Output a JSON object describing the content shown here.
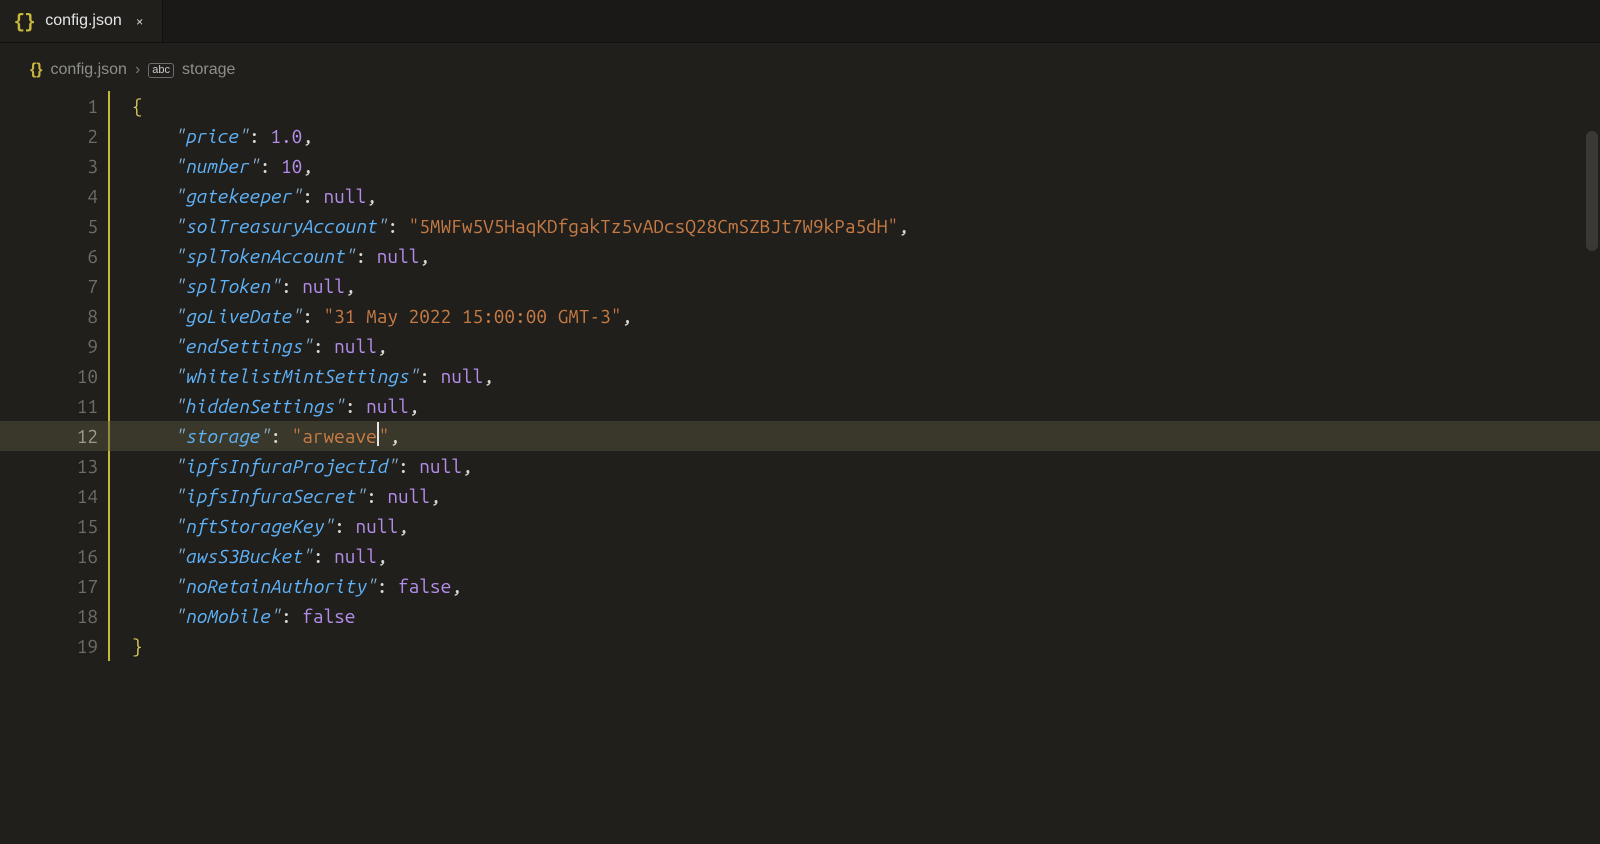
{
  "tab": {
    "icon": "{}",
    "filename": "config.json",
    "close": "×"
  },
  "breadcrumb": {
    "icon": "{}",
    "file": "config.json",
    "sep": "›",
    "fieldIcon": "abc",
    "field": "storage"
  },
  "gutter": [
    "1",
    "2",
    "3",
    "4",
    "5",
    "6",
    "7",
    "8",
    "9",
    "10",
    "11",
    "12",
    "13",
    "14",
    "15",
    "16",
    "17",
    "18",
    "19"
  ],
  "activeLineIndex": 11,
  "code": {
    "indent": "    ",
    "openBrace": "{",
    "closeBrace": "}",
    "items": [
      {
        "key": "price",
        "type": "num",
        "val": "1.0"
      },
      {
        "key": "number",
        "type": "num",
        "val": "10"
      },
      {
        "key": "gatekeeper",
        "type": "const",
        "val": "null"
      },
      {
        "key": "solTreasuryAccount",
        "type": "str",
        "val": "5MWFw5V5HaqKDfgakTz5vADcsQ28CmSZBJt7W9kPa5dH"
      },
      {
        "key": "splTokenAccount",
        "type": "const",
        "val": "null"
      },
      {
        "key": "splToken",
        "type": "const",
        "val": "null"
      },
      {
        "key": "goLiveDate",
        "type": "str",
        "val": "31 May 2022 15:00:00 GMT-3"
      },
      {
        "key": "endSettings",
        "type": "const",
        "val": "null"
      },
      {
        "key": "whitelistMintSettings",
        "type": "const",
        "val": "null"
      },
      {
        "key": "hiddenSettings",
        "type": "const",
        "val": "null"
      },
      {
        "key": "storage",
        "type": "str",
        "val": "arweave",
        "cursor": true
      },
      {
        "key": "ipfsInfuraProjectId",
        "type": "const",
        "val": "null"
      },
      {
        "key": "ipfsInfuraSecret",
        "type": "const",
        "val": "null"
      },
      {
        "key": "nftStorageKey",
        "type": "const",
        "val": "null"
      },
      {
        "key": "awsS3Bucket",
        "type": "const",
        "val": "null"
      },
      {
        "key": "noRetainAuthority",
        "type": "const",
        "val": "false"
      },
      {
        "key": "noMobile",
        "type": "const",
        "val": "false",
        "last": true
      }
    ]
  }
}
